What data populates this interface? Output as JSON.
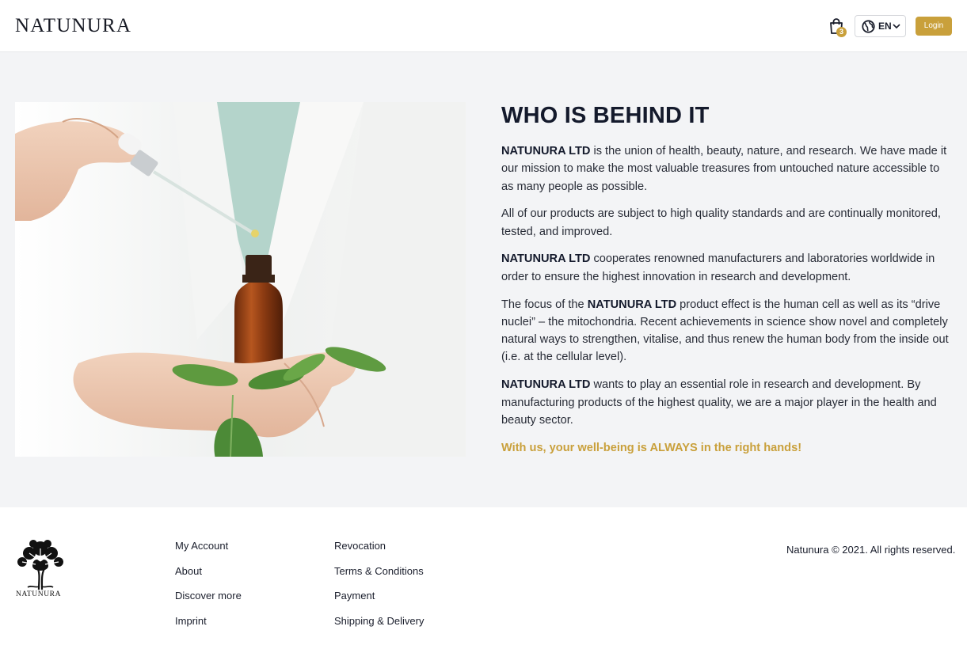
{
  "header": {
    "brand": "NATUNURA",
    "cart_count": "3",
    "language": "EN",
    "login_label": "Login",
    "accent_color": "#c9a03b"
  },
  "about": {
    "title": "WHO IS BEHIND IT",
    "paragraphs": [
      {
        "bold": "NATUNURA LTD",
        "text": " is the union of health, beauty, nature, and research. We have made it our mission to make the most valuable treasures from untouched nature accessible to as many people as possible."
      },
      {
        "bold": "",
        "text": "All of our products are subject to high quality standards and are continually monitored, tested, and improved."
      },
      {
        "bold": "NATUNURA LTD",
        "text": " cooperates renowned manufacturers and laboratories worldwide in order to ensure the highest innovation in research and development."
      },
      {
        "pre": "The focus of the ",
        "bold": "NATUNURA LTD",
        "text": " product effect is the human cell as well as its “drive nuclei” – the mitochondria. Recent achievements in science show novel and completely natural ways to strengthen, vitalise, and thus renew the human body from the inside out (i.e. at the cellular level)."
      },
      {
        "bold": "NATUNURA LTD",
        "text": " wants to play an essential role in research and development. By manufacturing products of the highest quality, we are a major player in the health and beauty sector."
      }
    ],
    "tagline": "With us, your well-being is ALWAYS in the right hands!"
  },
  "footer": {
    "logo_text": "NATUNURA",
    "col1": [
      "My Account",
      "About",
      "Discover more",
      "Imprint"
    ],
    "col2": [
      "Revocation",
      "Terms & Conditions",
      "Payment",
      "Shipping & Delivery"
    ],
    "copyright": "Natunura © 2021. All rights reserved."
  }
}
